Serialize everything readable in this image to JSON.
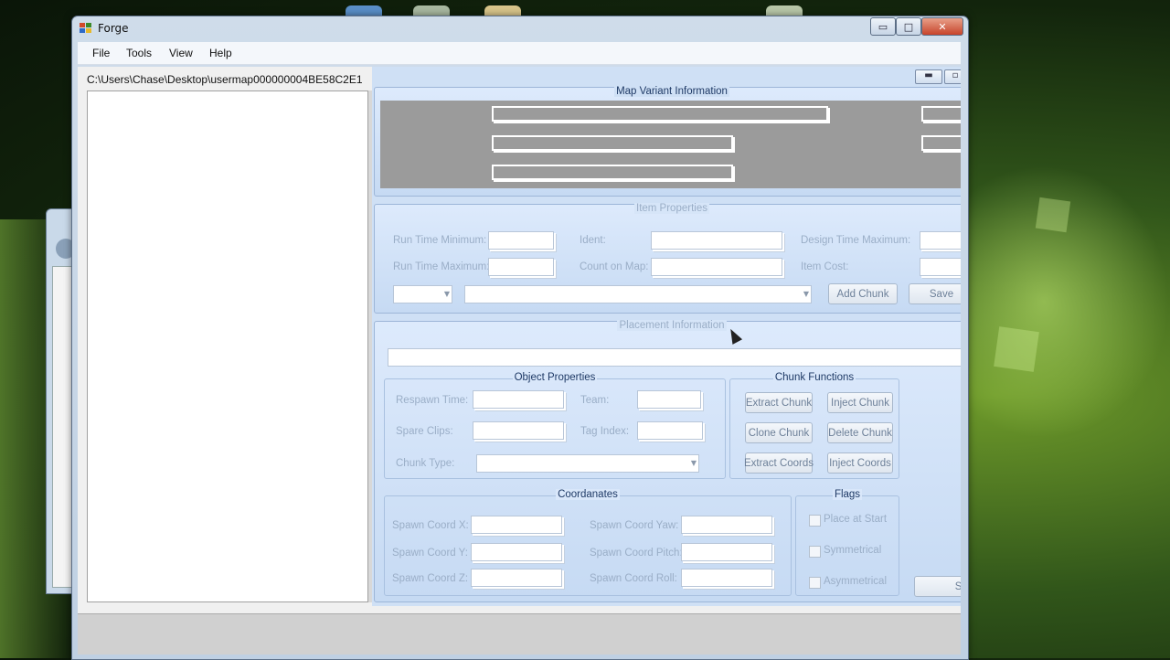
{
  "window": {
    "title": "Forge",
    "controls": {
      "minimize": "▭",
      "maximize": "□",
      "close": "✕"
    }
  },
  "menu": [
    "File",
    "Tools",
    "View",
    "Help"
  ],
  "file_path": "C:\\Users\\Chase\\Desktop\\usermap000000004BE58C2E1",
  "map_variant": {
    "title": "Map Variant Information"
  },
  "item_properties": {
    "title": "Item Properties",
    "labels": {
      "run_time_min": "Run Time Minimum:",
      "run_time_max": "Run Time Maximum:",
      "ident": "Ident:",
      "count_on_map": "Count on Map:",
      "design_time_max": "Design Time Maximum:",
      "item_cost": "Item Cost:"
    },
    "buttons": {
      "add_chunk": "Add Chunk",
      "save": "Save"
    }
  },
  "placement": {
    "title": "Placement Information",
    "object_properties": {
      "title": "Object Properties",
      "labels": {
        "respawn_time": "Respawn Time:",
        "team": "Team:",
        "spare_clips": "Spare Clips:",
        "tag_index": "Tag Index:",
        "chunk_type": "Chunk Type:"
      }
    },
    "chunk_functions": {
      "title": "Chunk Functions",
      "buttons": {
        "extract_chunk": "Extract Chunk",
        "inject_chunk": "Inject Chunk",
        "clone_chunk": "Clone Chunk",
        "delete_chunk": "Delete Chunk",
        "extract_coords": "Extract Coords",
        "inject_coords": "Inject Coords"
      }
    },
    "coordinates": {
      "title": "Coordanates",
      "labels": {
        "spawn_x": "Spawn Coord X:",
        "spawn_y": "Spawn Coord Y:",
        "spawn_z": "Spawn Coord Z:",
        "spawn_yaw": "Spawn Coord Yaw:",
        "spawn_pitch": "Spawn Coord Pitch:",
        "spawn_roll": "Spawn Coord Roll:"
      }
    },
    "flags": {
      "title": "Flags",
      "items": [
        "Place at Start",
        "Symmetrical",
        "Asymmetrical"
      ]
    },
    "save": "Save"
  }
}
